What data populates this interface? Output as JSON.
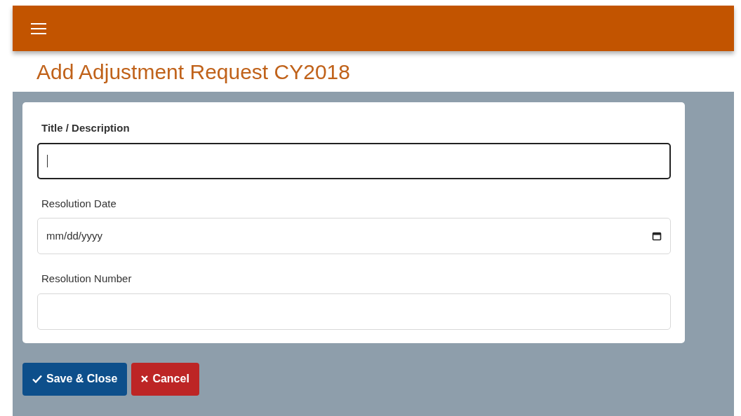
{
  "page_title": "Add Adjustment Request CY2018",
  "fields": [
    {
      "kind": "text",
      "label": "Title / Description",
      "focused": true
    },
    {
      "kind": "date",
      "label": "Resolution Date",
      "placeholder": "mm/dd/yyyy",
      "focused": false
    },
    {
      "kind": "text",
      "label": "Resolution Number",
      "focused": false
    }
  ],
  "buttons": [
    {
      "kind": "save",
      "label": "Save & Close"
    },
    {
      "kind": "cancel",
      "label": "Cancel"
    }
  ]
}
